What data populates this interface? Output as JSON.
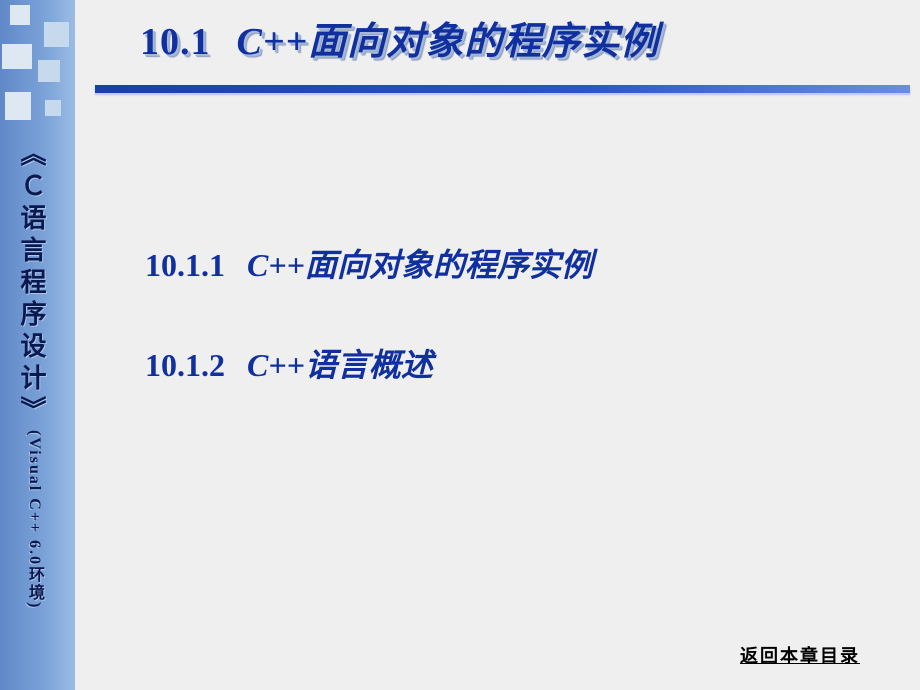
{
  "sidebar": {
    "book_title": "《Ｃ语言程序设计》",
    "subtitle": "(Visual C++ 6.0环境)"
  },
  "header": {
    "section_number": "10.1",
    "section_title": "C++面向对象的程序实例"
  },
  "items": [
    {
      "number": "10.1.1",
      "title": "C++面向对象的程序实例"
    },
    {
      "number": "10.1.2",
      "title": "C++语言概述"
    }
  ],
  "footer": {
    "return_link": "返回本章目录"
  }
}
